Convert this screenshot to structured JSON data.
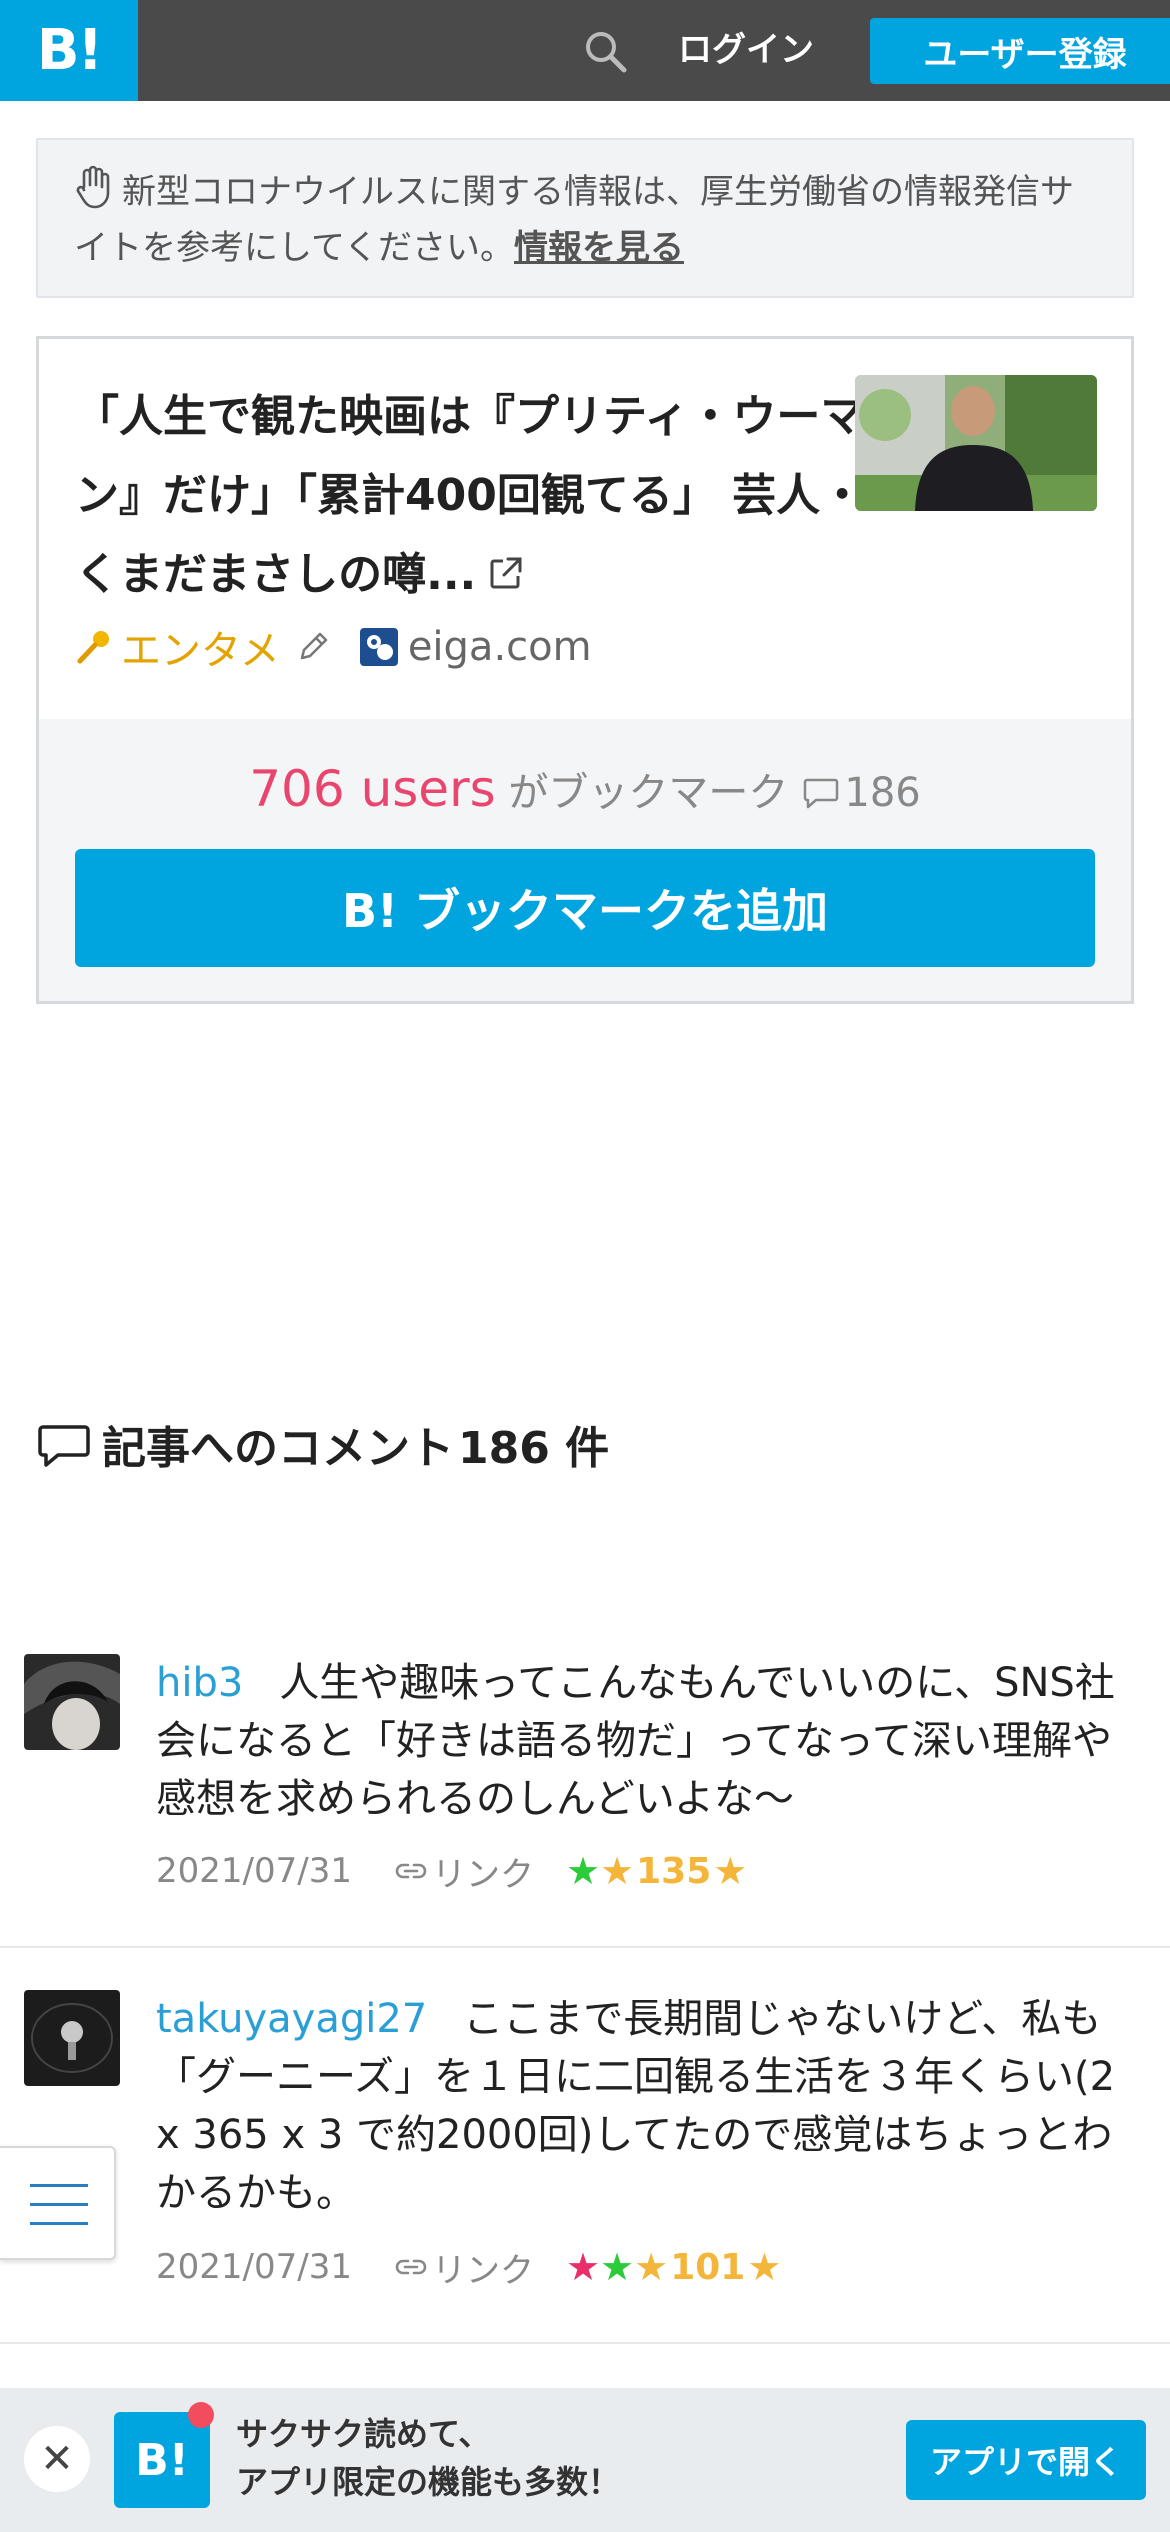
{
  "header": {
    "logo_text": "B!",
    "login_label": "ログイン",
    "register_label": "ユーザー登録"
  },
  "notice": {
    "text": "新型コロナウイルスに関する情報は、厚生労働省の情報発信サイトを参考にしてください。",
    "link_label": "情報を見る"
  },
  "entry": {
    "title": "「人生で観た映画は『プリティ・ウーマン』だけ」「累計400回観てる」 芸人・くまだまさしの噂...",
    "category": "エンタメ",
    "domain": "eiga.com",
    "users_count": "706 users",
    "users_suffix": "がブックマーク",
    "comment_count": "186",
    "add_bookmark_label": "B! ブックマークを追加"
  },
  "comments_section": {
    "heading": "記事へのコメント",
    "count_label": "186 件"
  },
  "comments": [
    {
      "user": "hib3",
      "text": "人生や趣味ってこんなもんでいいのに、SNS社会になると「好きは語る物だ」ってなって深い理解や感想を求められるのしんどいよな〜",
      "date": "2021/07/31",
      "link_label": "リンク",
      "star_count": "135"
    },
    {
      "user": "takuyayagi27",
      "text": "ここまで長期間じゃないけど、私も「グーニーズ」を１日に二回観る生活を３年くらい(2 x 365 x 3 で約2000回)してたので感覚はちょっとわかるかも。",
      "date": "2021/07/31",
      "link_label": "リンク",
      "star_count": "101"
    }
  ],
  "app_banner": {
    "logo_text": "B!",
    "line1": "サクサク読めて、",
    "line2": "アプリ限定の機能も多数！",
    "open_label": "アプリで開く"
  }
}
